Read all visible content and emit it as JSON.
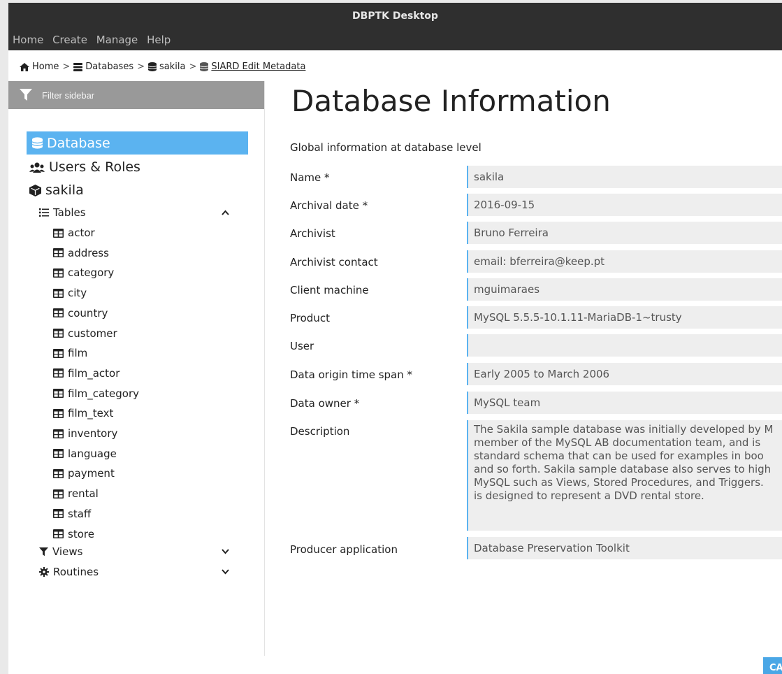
{
  "window": {
    "title": "DBPTK Desktop"
  },
  "menu": [
    "Home",
    "Create",
    "Manage",
    "Help"
  ],
  "breadcrumb": {
    "home": "Home",
    "databases": "Databases",
    "db": "sakila",
    "current": "SIARD Edit Metadata"
  },
  "sidebar": {
    "filter_placeholder": "Filter sidebar",
    "database": "Database",
    "users_roles": "Users & Roles",
    "schema": "sakila",
    "tables_label": "Tables",
    "tables": [
      "actor",
      "address",
      "category",
      "city",
      "country",
      "customer",
      "film",
      "film_actor",
      "film_category",
      "film_text",
      "inventory",
      "language",
      "payment",
      "rental",
      "staff",
      "store"
    ],
    "views_label": "Views",
    "routines_label": "Routines"
  },
  "main": {
    "title": "Database Information",
    "subtitle": "Global information at database level",
    "fields": [
      {
        "label": "Name *",
        "value": "sakila"
      },
      {
        "label": "Archival date *",
        "value": "2016-09-15"
      },
      {
        "label": "Archivist",
        "value": "Bruno Ferreira"
      },
      {
        "label": "Archivist contact",
        "value": "email: bferreira@keep.pt"
      },
      {
        "label": "Client machine",
        "value": "mguimaraes"
      },
      {
        "label": "Product",
        "value": "MySQL 5.5.5-10.1.11-MariaDB-1~trusty"
      },
      {
        "label": "User",
        "value": ""
      },
      {
        "label": "Data origin time span *",
        "value": "Early 2005 to March 2006"
      },
      {
        "label": "Data owner *",
        "value": "MySQL team"
      }
    ],
    "description_label": "Description",
    "description": "The Sakila sample database was initially developed by M\nmember of the MySQL AB documentation team, and is\nstandard schema that can be used for examples in boo\nand so forth. Sakila sample database also serves to high\nMySQL such as Views, Stored Procedures, and Triggers.\nis designed to represent a DVD rental store.",
    "producer_label": "Producer application",
    "producer_value": "Database Preservation Toolkit",
    "cancel_button": "CA"
  },
  "colors": {
    "accent": "#5bb3f0",
    "titlebar": "#2f2f2f",
    "filter_bg": "#999999",
    "button": "#4aa7e6"
  }
}
